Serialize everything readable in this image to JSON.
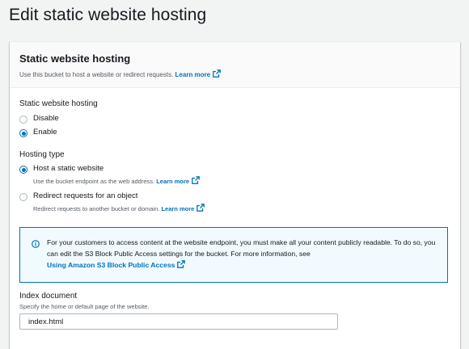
{
  "page": {
    "title": "Edit static website hosting"
  },
  "panel": {
    "title": "Static website hosting",
    "description": "Use this bucket to host a website or redirect requests.",
    "learn_more": "Learn more"
  },
  "hosting_field": {
    "label": "Static website hosting",
    "options": [
      {
        "label": "Disable",
        "selected": false
      },
      {
        "label": "Enable",
        "selected": true
      }
    ]
  },
  "hosting_type": {
    "label": "Hosting type",
    "options": [
      {
        "label": "Host a static website",
        "description": "Use the bucket endpoint as the web address.",
        "learn_more": "Learn more",
        "selected": true
      },
      {
        "label": "Redirect requests for an object",
        "description": "Redirect requests to another bucket or domain.",
        "learn_more": "Learn more",
        "selected": false
      }
    ]
  },
  "info": {
    "text": "For your customers to access content at the website endpoint, you must make all your content publicly readable. To do so, you can edit the S3 Block Public Access settings for the bucket. For more information, see",
    "link": "Using Amazon S3 Block Public Access"
  },
  "index_document": {
    "label": "Index document",
    "description": "Specify the home or default page of the website.",
    "value": "index.html"
  },
  "colors": {
    "link": "#0073bb",
    "info_background": "#f1faff",
    "page_background": "#f2f3f3"
  },
  "icons": {
    "external_link": "external-link-icon",
    "info": "info-icon"
  }
}
